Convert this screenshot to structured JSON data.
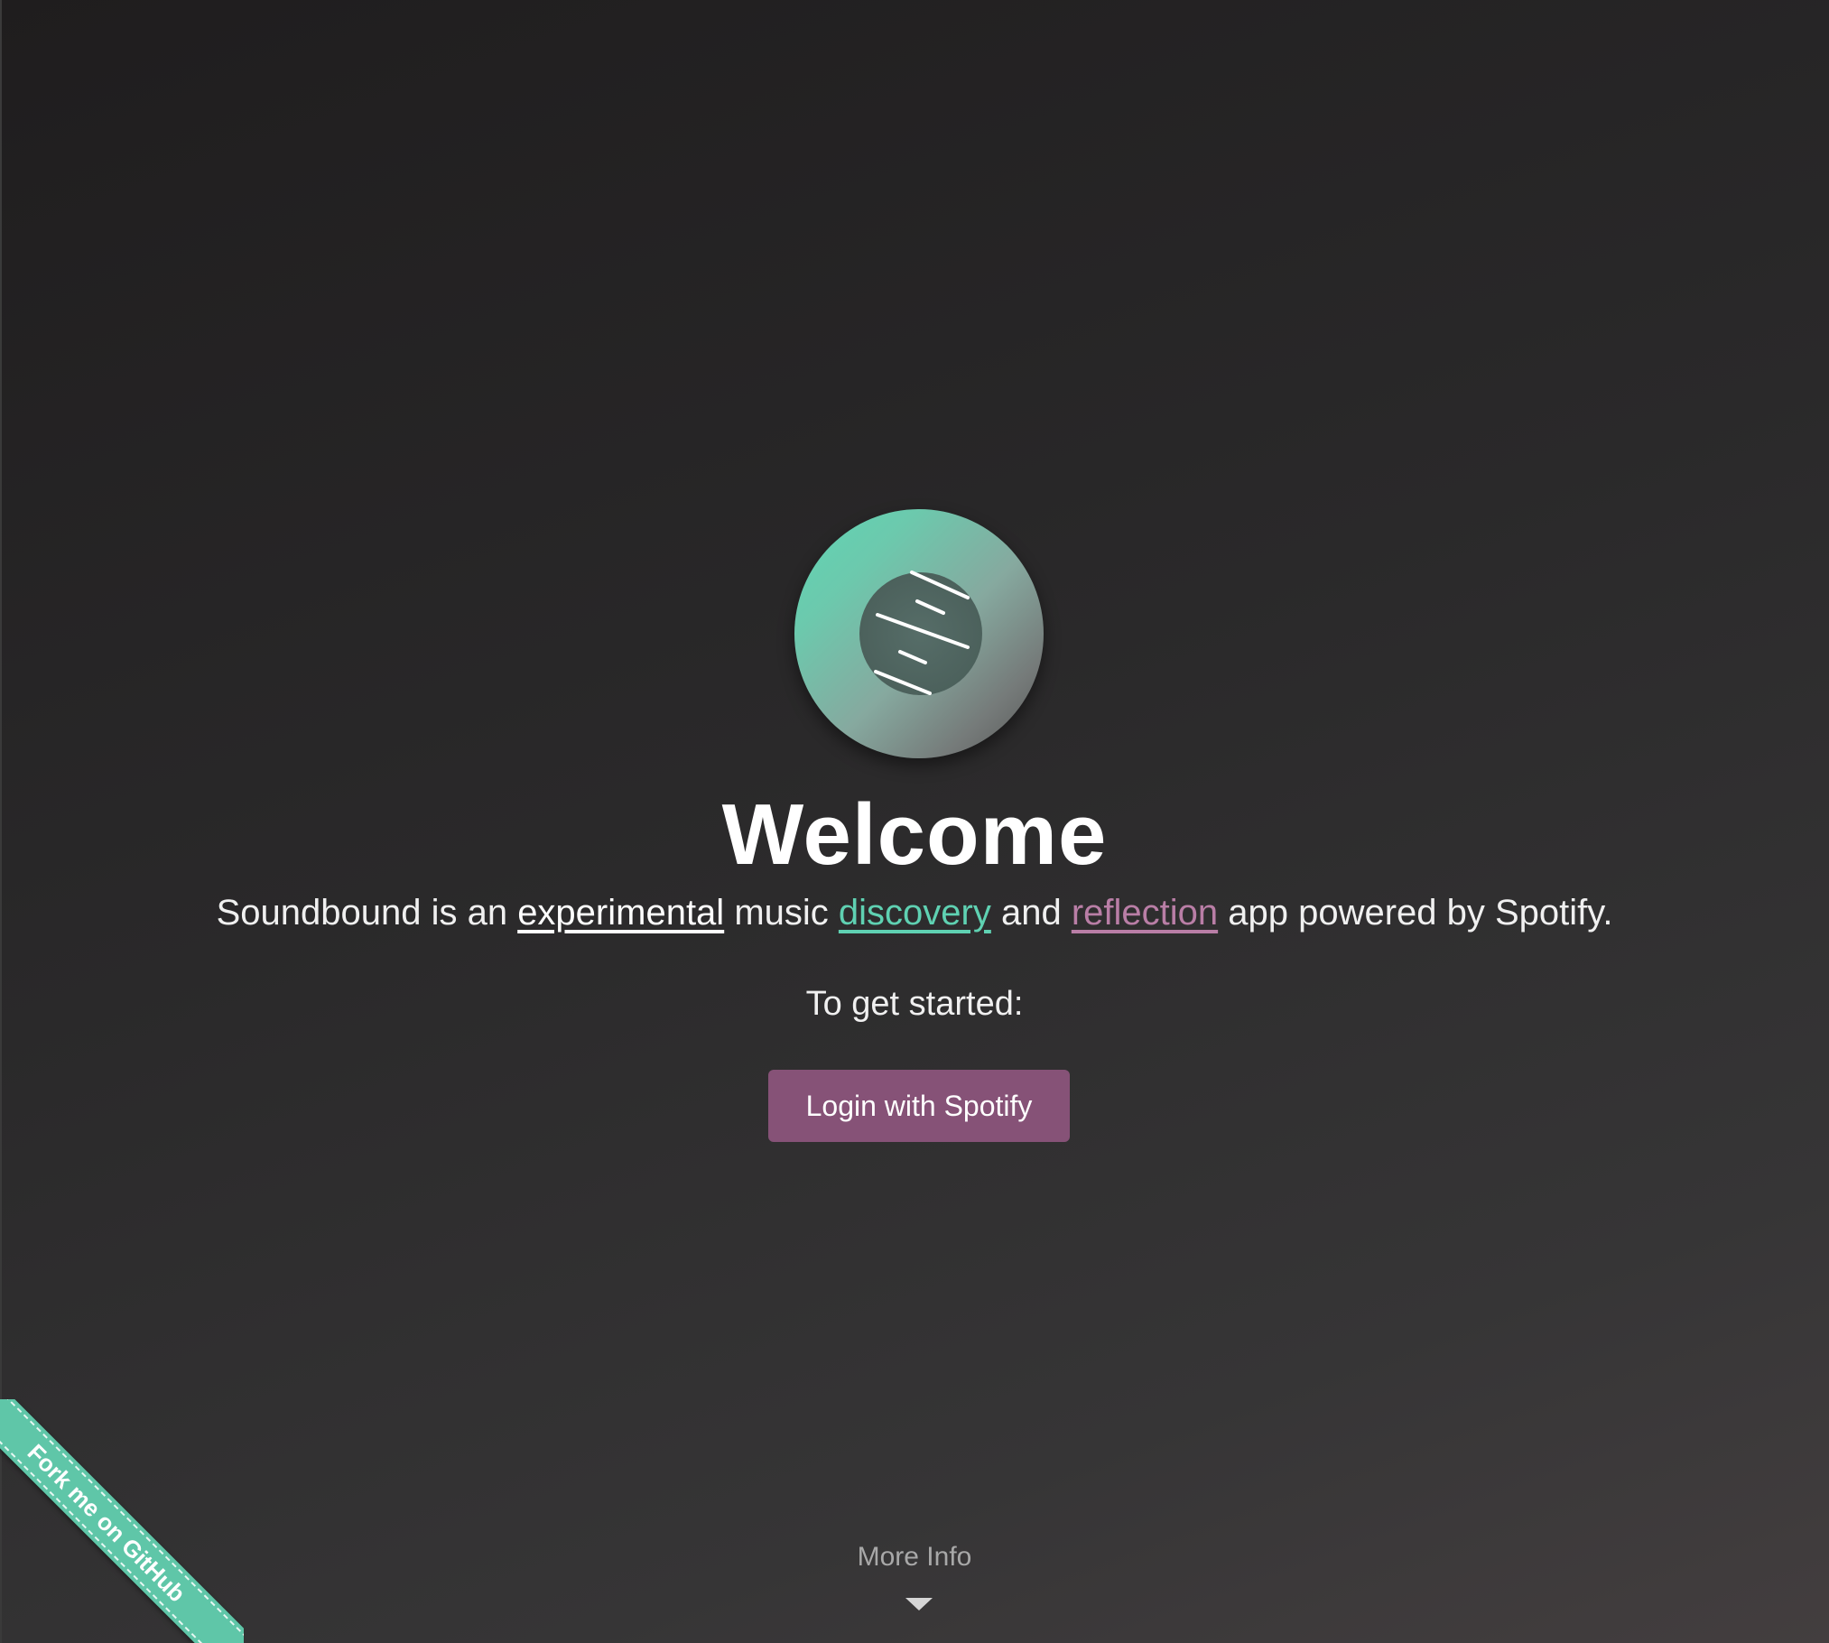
{
  "theme": {
    "accent_teal": "#5fd1b2",
    "accent_purple": "#865277",
    "link_reflection": "#b97ea6"
  },
  "logo": {
    "icon": "soundbound-logo-icon"
  },
  "hero": {
    "title": "Welcome",
    "intro_prefix": "Soundbound is an ",
    "link_experimental": "experimental",
    "intro_mid1": " music ",
    "link_discovery": "discovery",
    "intro_mid2": " and ",
    "link_reflection": "reflection",
    "intro_suffix": " app powered by Spotify.",
    "get_started": "To get started:",
    "login_label": "Login with Spotify"
  },
  "footer": {
    "more_info": "More Info",
    "more_info_icon": "chevron-down-icon"
  },
  "ribbon": {
    "label": "Fork me on GitHub"
  }
}
